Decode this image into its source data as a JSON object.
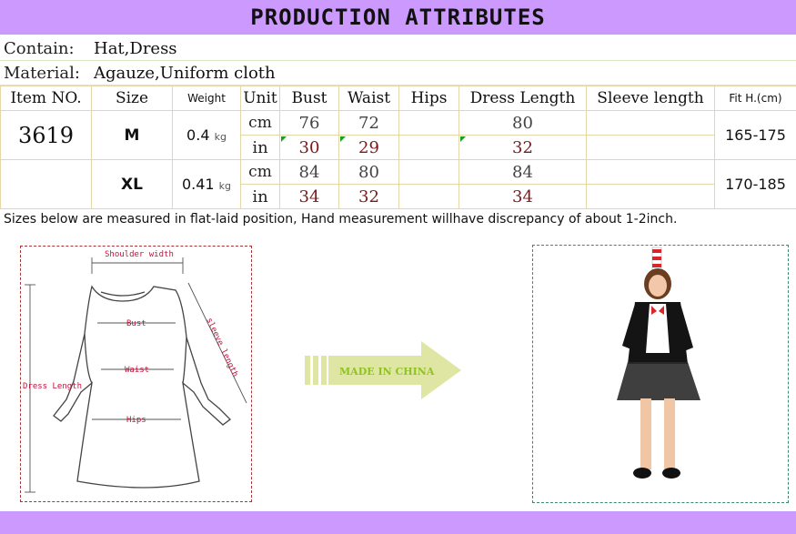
{
  "banner": {
    "title": "PRODUCTION ATTRIBUTES"
  },
  "contain": {
    "label": "Contain:",
    "value": "Hat,Dress"
  },
  "material": {
    "label": "Material:",
    "value": "Agauze,Uniform cloth"
  },
  "table": {
    "headers": [
      "Item NO.",
      "Size",
      "Weight",
      "Unit",
      "Bust",
      "Waist",
      "Hips",
      "Dress Length",
      "Sleeve length",
      "Fit H.(cm)"
    ],
    "item_no": "3619",
    "weight_unit": "kg",
    "unit_cm": "cm",
    "unit_in": "in",
    "rows": [
      {
        "size": "M",
        "weight": "0.4",
        "fit": "165-175",
        "cm": {
          "bust": "76",
          "waist": "72",
          "hips": "",
          "dress_length": "80",
          "sleeve": ""
        },
        "in": {
          "bust": "30",
          "waist": "29",
          "hips": "",
          "dress_length": "32",
          "sleeve": ""
        }
      },
      {
        "size": "XL",
        "weight": "0.41",
        "fit": "170-185",
        "cm": {
          "bust": "84",
          "waist": "80",
          "hips": "",
          "dress_length": "84",
          "sleeve": ""
        },
        "in": {
          "bust": "34",
          "waist": "32",
          "hips": "",
          "dress_length": "34",
          "sleeve": ""
        }
      }
    ]
  },
  "note": "Sizes below are measured in flat-laid position, Hand measurement willhave discrepancy of about 1-2inch.",
  "diagram": {
    "shoulder": "Shoulder width",
    "bust": "Bust",
    "waist": "Waist",
    "hips": "Hips",
    "dress_length": "Dress Length",
    "sleeve": "sleeve length"
  },
  "made_in": "MADE IN CHINA",
  "colors": {
    "banner": "#cc99ff",
    "arrow": "#dfe6a4",
    "made_in_text": "#8fc31f",
    "diagram_label": "#c0143c"
  }
}
